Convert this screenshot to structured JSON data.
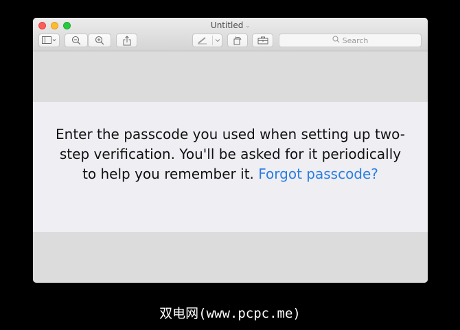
{
  "window": {
    "title": "Untitled",
    "title_chevron": "⌄"
  },
  "toolbar": {
    "buttons": [
      {
        "name": "sidebar-toggle",
        "icon": "sidebar-icon"
      },
      {
        "name": "zoom-out",
        "icon": "zoom-out-icon"
      },
      {
        "name": "zoom-in",
        "icon": "zoom-in-icon"
      },
      {
        "name": "share",
        "icon": "share-icon"
      },
      {
        "name": "markup",
        "icon": "pen-icon"
      },
      {
        "name": "rotate",
        "icon": "rotate-icon"
      },
      {
        "name": "toolbox",
        "icon": "toolbox-icon"
      }
    ],
    "search_placeholder": "Search"
  },
  "content": {
    "message": "Enter the passcode you used when setting up two-step verification. You'll be asked for it periodically to help you remember it.",
    "message_line1": "Enter the passcode you used when setting up two-",
    "message_line2": "step verification. You'll be asked for it periodically",
    "message_line3": "to help you remember it.",
    "link": "Forgot passcode?"
  },
  "caption": "双电网(www.pcpc.me)",
  "colors": {
    "link": "#2a7ee0",
    "band": "#efeef3",
    "close": "#fc5f57",
    "minimize": "#fdbc2e",
    "maximize": "#28c840"
  }
}
